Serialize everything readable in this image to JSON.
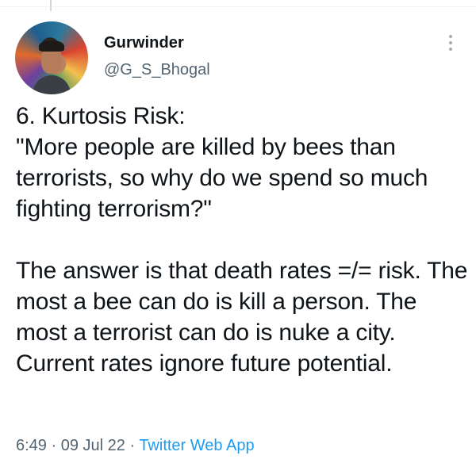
{
  "author": {
    "name": "Gurwinder",
    "handle": "@G_S_Bhogal"
  },
  "tweet": {
    "paragraph_1": "6. Kurtosis Risk:\n\"More people are killed by bees than terrorists, so why do we spend so much fighting terrorism?\"",
    "paragraph_2": "The answer is that death rates =/= risk. The most a bee can do is kill a person. The most a terrorist can do is nuke a city. Current rates ignore future potential."
  },
  "meta": {
    "time": "6:49",
    "separator_1": " · ",
    "date": "09 Jul 22",
    "separator_2": " · ",
    "source": "Twitter Web App"
  },
  "icons": {
    "more": "more-vertical-icon",
    "avatar": "profile-photo"
  },
  "colors": {
    "text": "#0f1419",
    "secondary": "#536471",
    "link": "#1d9bf0"
  }
}
